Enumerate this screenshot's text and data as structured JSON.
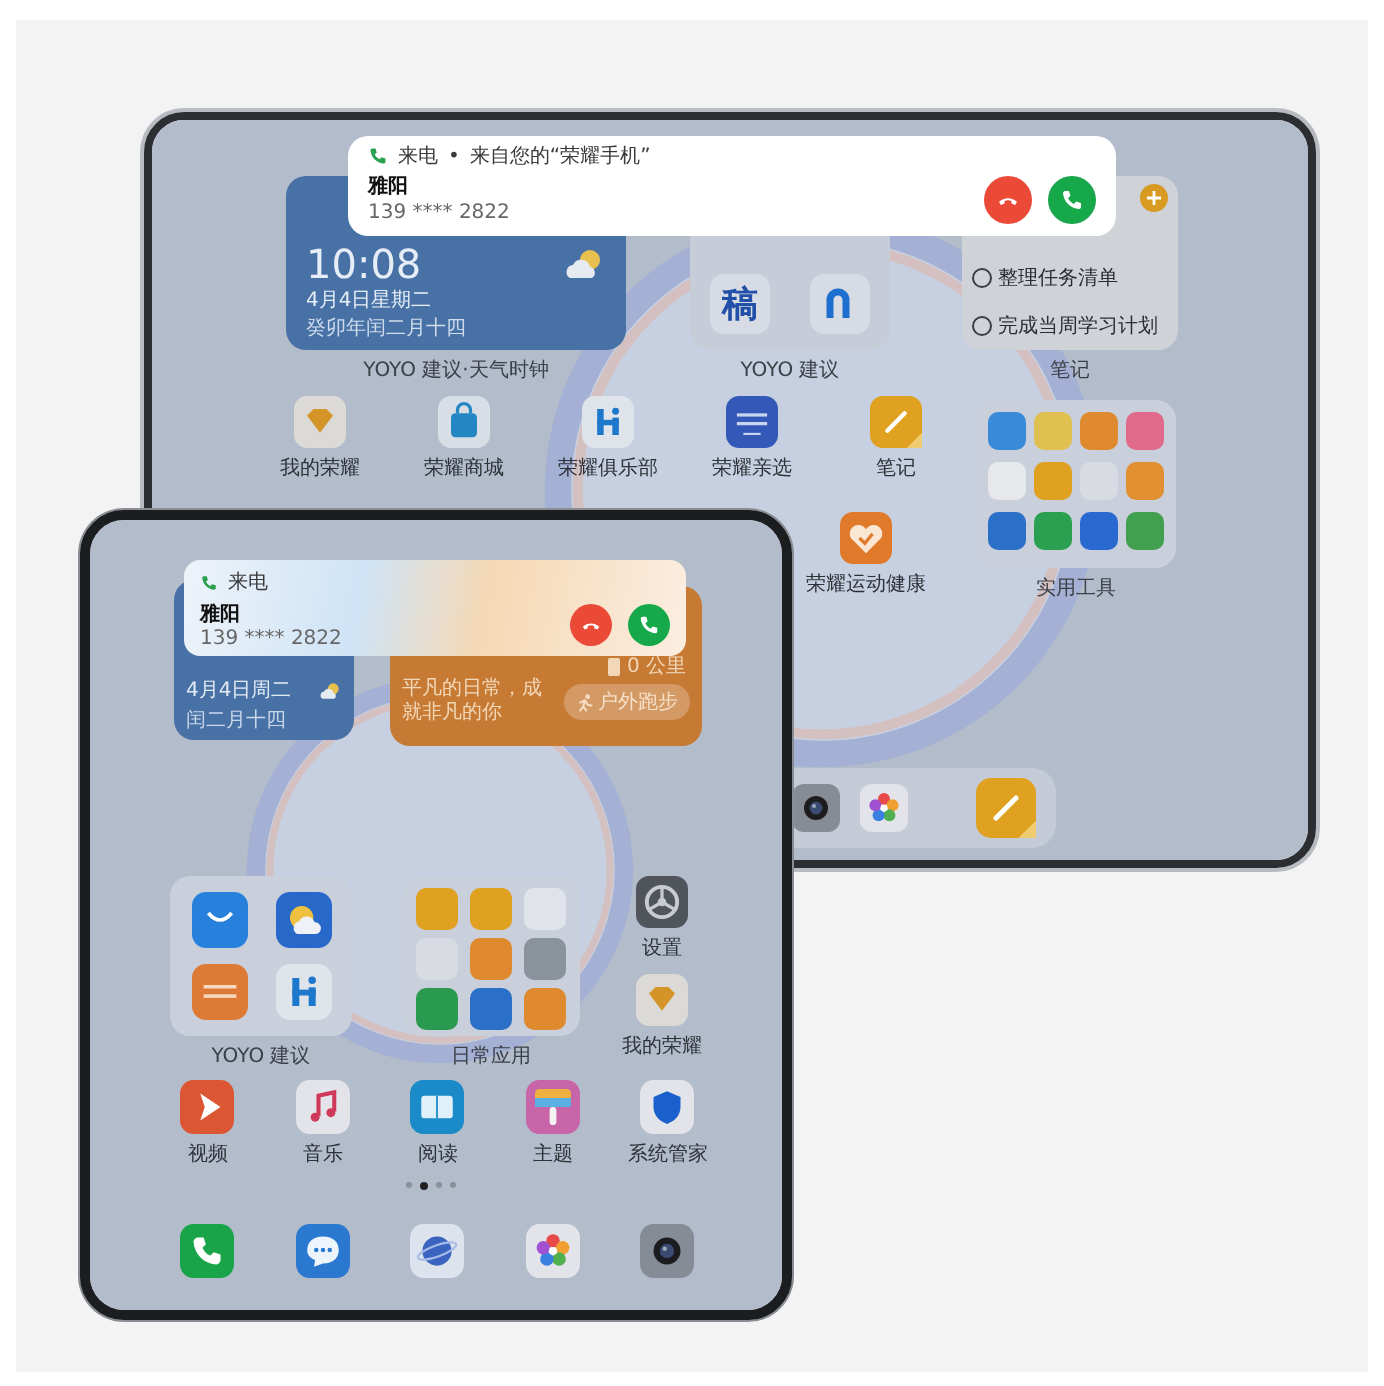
{
  "tablet": {
    "call_notification": {
      "title": "来电",
      "separator": "•",
      "source": "来自您的“荣耀手机”",
      "caller": "雅阳",
      "number": "139 **** 2822"
    },
    "weather_widget": {
      "time": "10:08",
      "date": "4月4日星期二",
      "lunar_date": "癸卯年闰二月十四",
      "label": "YOYO 建议·天气时钟"
    },
    "suggestion_widget": {
      "icon_text": "稿",
      "label": "YOYO 建议"
    },
    "notes_widget": {
      "items": [
        {
          "text": "整理任务清单",
          "checked": false
        },
        {
          "text": "完成当周学习计划",
          "checked": false
        }
      ],
      "label": "笔记"
    },
    "apps": [
      {
        "kind": "honor",
        "label": "我的荣耀"
      },
      {
        "kind": "mall",
        "label": "荣耀商城"
      },
      {
        "kind": "club",
        "label": "荣耀俱乐部"
      },
      {
        "kind": "select",
        "label": "荣耀亲选"
      },
      {
        "kind": "notes",
        "label": "笔记"
      }
    ],
    "apps_row_2": [
      {
        "kind": "health",
        "label": "荣耀运动健康"
      }
    ],
    "folder": {
      "label": "实用工具"
    },
    "dock": [
      {
        "kind": "camera"
      },
      {
        "kind": "photos"
      },
      {
        "kind": "notes"
      }
    ]
  },
  "foldable": {
    "call_notification": {
      "title": "来电",
      "caller": "雅阳",
      "number": "139 **** 2822"
    },
    "date_widget": {
      "date": "4月4日周二",
      "lunar_date": "闰二月十四"
    },
    "steps_widget": {
      "distance": "0 公里",
      "motto": "平凡的日常，成就非凡的你",
      "button": "户外跑步"
    },
    "yoyo_folder": {
      "label": "YOYO 建议",
      "apps": [
        {
          "kind": "store"
        },
        {
          "kind": "weather"
        },
        {
          "kind": "select_orange"
        },
        {
          "kind": "club"
        }
      ]
    },
    "daily_folder": {
      "label": "日常应用"
    },
    "side_apps": [
      {
        "kind": "settings",
        "label": "设置"
      },
      {
        "kind": "honor",
        "label": "我的荣耀"
      }
    ],
    "apps": [
      {
        "kind": "video",
        "label": "视频"
      },
      {
        "kind": "music",
        "label": "音乐"
      },
      {
        "kind": "read",
        "label": "阅读"
      },
      {
        "kind": "theme",
        "label": "主题"
      },
      {
        "kind": "shield",
        "label": "系统管家"
      }
    ],
    "page_dots": [
      {
        "selected": false
      },
      {
        "selected": true
      },
      {
        "selected": false
      },
      {
        "selected": false
      }
    ],
    "dock": [
      {
        "kind": "phone"
      },
      {
        "kind": "message"
      },
      {
        "kind": "browser"
      },
      {
        "kind": "photos"
      },
      {
        "kind": "camera"
      }
    ]
  }
}
